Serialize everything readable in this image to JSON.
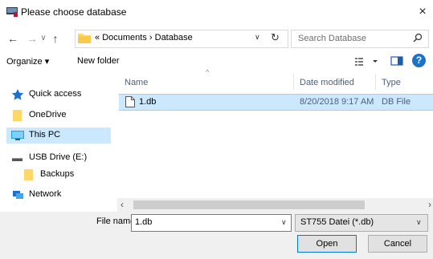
{
  "window": {
    "title": "Please choose database",
    "close_glyph": "×"
  },
  "nav": {
    "breadcrumb_prefix": "«",
    "breadcrumb": [
      "Documents",
      "Database"
    ],
    "breadcrumb_sep": "›",
    "search_placeholder": "Search Database"
  },
  "toolbar": {
    "organize_label": "Organize ▾",
    "new_folder_label": "New folder",
    "help_label": "?"
  },
  "sidebar": {
    "items": [
      {
        "label": "Quick access",
        "icon": "star-icon"
      },
      {
        "label": "OneDrive",
        "icon": "folder-icon"
      },
      {
        "label": "This PC",
        "icon": "monitor-icon"
      },
      {
        "label": "USB Drive (E:)",
        "icon": "drive-icon"
      },
      {
        "label": "Backups",
        "icon": "folder-icon"
      },
      {
        "label": "Network",
        "icon": "network-icon"
      }
    ]
  },
  "files": {
    "columns": [
      "Name",
      "Date modified",
      "Type"
    ],
    "rows": [
      {
        "name": "1.db",
        "date": "8/20/2018 9:17 AM",
        "type": "DB  File"
      }
    ]
  },
  "footer": {
    "filename_label": "File name:",
    "filename_value": "1.db",
    "filetype_value": "ST755 Datei (*.db)",
    "open_label": "Open",
    "cancel_label": "Cancel"
  },
  "colors": {
    "selection": "#cce8ff",
    "accent": "#0078d7",
    "folder": "#ffd766"
  }
}
